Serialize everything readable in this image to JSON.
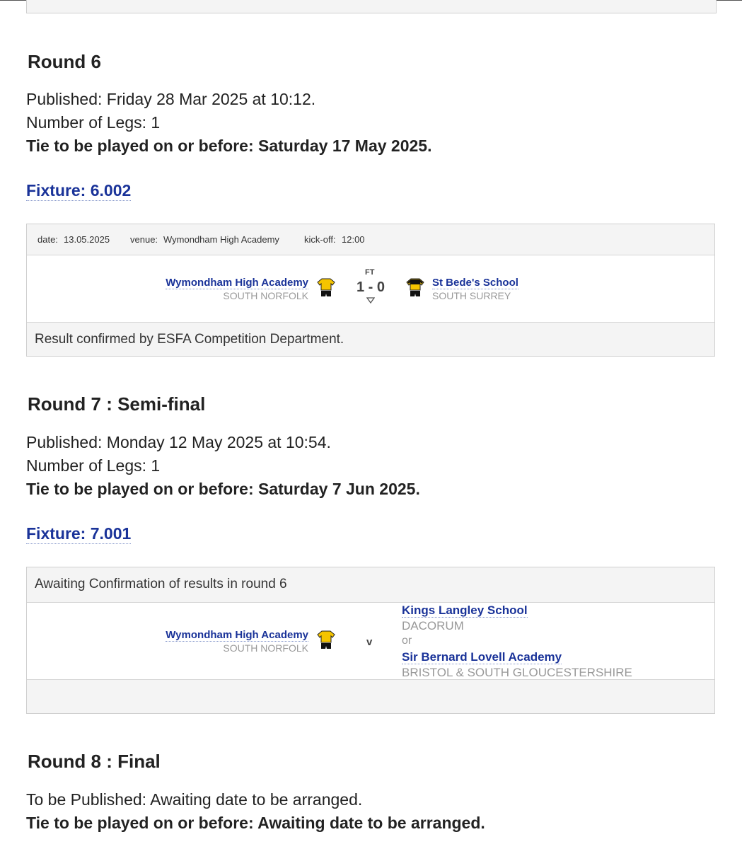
{
  "rounds": [
    {
      "title": "Round 6",
      "published": "Published: Friday 28 Mar 2025 at 10:12.",
      "legs": "Number of Legs: 1",
      "deadline": "Tie to be played on or before: Saturday 17 May 2025.",
      "fixture": {
        "label": "Fixture: 6.002",
        "date_label": "date:",
        "date": "13.05.2025",
        "venue_label": "venue:",
        "venue": "Wymondham High Academy",
        "kickoff_label": "kick-off:",
        "kickoff": "12:00",
        "home": {
          "name": "Wymondham High Academy",
          "area": "SOUTH NORFOLK"
        },
        "status": "FT",
        "score": "1 - 0",
        "away": {
          "name": "St Bede's School",
          "area": "SOUTH SURREY"
        },
        "footer": "Result confirmed by ESFA Competition Department."
      }
    },
    {
      "title": "Round 7 : Semi-final",
      "published": "Published: Monday 12 May 2025 at 10:54.",
      "legs": "Number of Legs: 1",
      "deadline": "Tie to be played on or before: Saturday 7 Jun 2025.",
      "fixture": {
        "label": "Fixture: 7.001",
        "header": "Awaiting Confirmation of results in round 6",
        "home": {
          "name": "Wymondham High Academy",
          "area": "SOUTH NORFOLK"
        },
        "versus": "v",
        "away_options": [
          {
            "name": "Kings Langley School",
            "area": "DACORUM"
          },
          {
            "name": "Sir Bernard Lovell Academy",
            "area": "BRISTOL & SOUTH GLOUCESTERSHIRE"
          }
        ],
        "or_text": "or"
      }
    },
    {
      "title": "Round 8 : Final",
      "published": "To be Published: Awaiting date to be arranged.",
      "deadline": "Tie to be played on or before: Awaiting date to be arranged."
    }
  ],
  "kit_colors": {
    "shirt": "#f5c400",
    "shorts": "#111111"
  },
  "icons": {
    "kit": "football-kit-icon",
    "expand": "expand-triangle-icon"
  }
}
